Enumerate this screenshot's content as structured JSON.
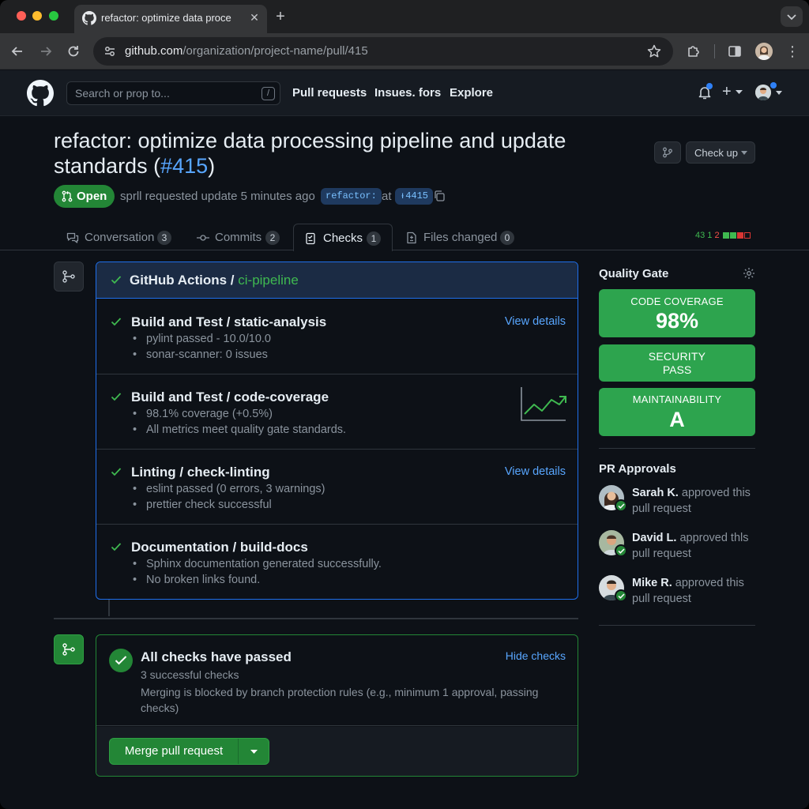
{
  "browser": {
    "tab_title": "refactor: optimize data proce",
    "url_host": "github.com",
    "url_path": "/organization/project-name/pull/415"
  },
  "header": {
    "search_placeholder": "Search or prop to...",
    "slash_key": "/",
    "nav": [
      "Pull requests",
      "Insues. fors",
      "Explore"
    ]
  },
  "pr": {
    "title_line1": "refactor: optimize data processing pipeline and update",
    "title_line2": "standards (",
    "number": "#415",
    "title_close": ")",
    "action_label": "Check up",
    "state": "Open",
    "meta_text": "sprll requested update 5 minutes ago",
    "branch_chip": "refactor:",
    "at_text": "at",
    "ref_chip": "ᵻ4415"
  },
  "tabs": [
    {
      "label": "Conversation",
      "count": "3"
    },
    {
      "label": "Commits",
      "count": "2"
    },
    {
      "label": "Checks",
      "count": "1"
    },
    {
      "label": "Files changed",
      "count": "0"
    }
  ],
  "diffstat": {
    "additions": "43 1",
    "deletions": "2"
  },
  "checks": {
    "header_prefix": "GitHub Actions / ",
    "header_highlight": "ci-pipeline",
    "items": [
      {
        "title": "Build and Test / static-analysis",
        "link": "View details",
        "lines": [
          "pylint passed - 10.0/10.0",
          "sonar-scanner: 0 issues"
        ]
      },
      {
        "title": "Build and Test / code-coverage",
        "link": "",
        "lines": [
          "98.1% coverage (+0.5%)",
          "All metrics meet quality gate standards."
        ]
      },
      {
        "title": "Linting / check-linting",
        "link": "View details",
        "lines": [
          "eslint passed (0 errors, 3 warnings)",
          "prettier check successful"
        ]
      },
      {
        "title": "Documentation / build-docs",
        "link": "",
        "lines": [
          "Sphinx documentation generated successfully.",
          "No broken links found."
        ]
      }
    ]
  },
  "merge": {
    "title": "All checks have passed",
    "subtitle": "3 successful checks",
    "description": "Merging is blocked by branch protection rules (e.g., minimum 1 approval, passing checks)",
    "hide_link": "Hide checks",
    "button": "Merge pull request"
  },
  "sidebar": {
    "quality_gate_title": "Quality Gate",
    "tiles": [
      {
        "label": "CODE COVERAGE",
        "value": "98%"
      },
      {
        "label": "SECURITY",
        "value": "PASS"
      },
      {
        "label": "MAINTAINABILITY",
        "value": "A"
      }
    ],
    "approvals_title": "PR Approvals",
    "approvals": [
      {
        "name": "Sarah K.",
        "text": "approved this pull request"
      },
      {
        "name": "David L.",
        "text": "approved thls pull request"
      },
      {
        "name": "Mike R.",
        "text": "approved this pull request"
      }
    ]
  },
  "colors": {
    "accent_green": "#238636",
    "link_blue": "#58a6ff",
    "tile_green": "#2da44e",
    "background": "#0d1117"
  }
}
